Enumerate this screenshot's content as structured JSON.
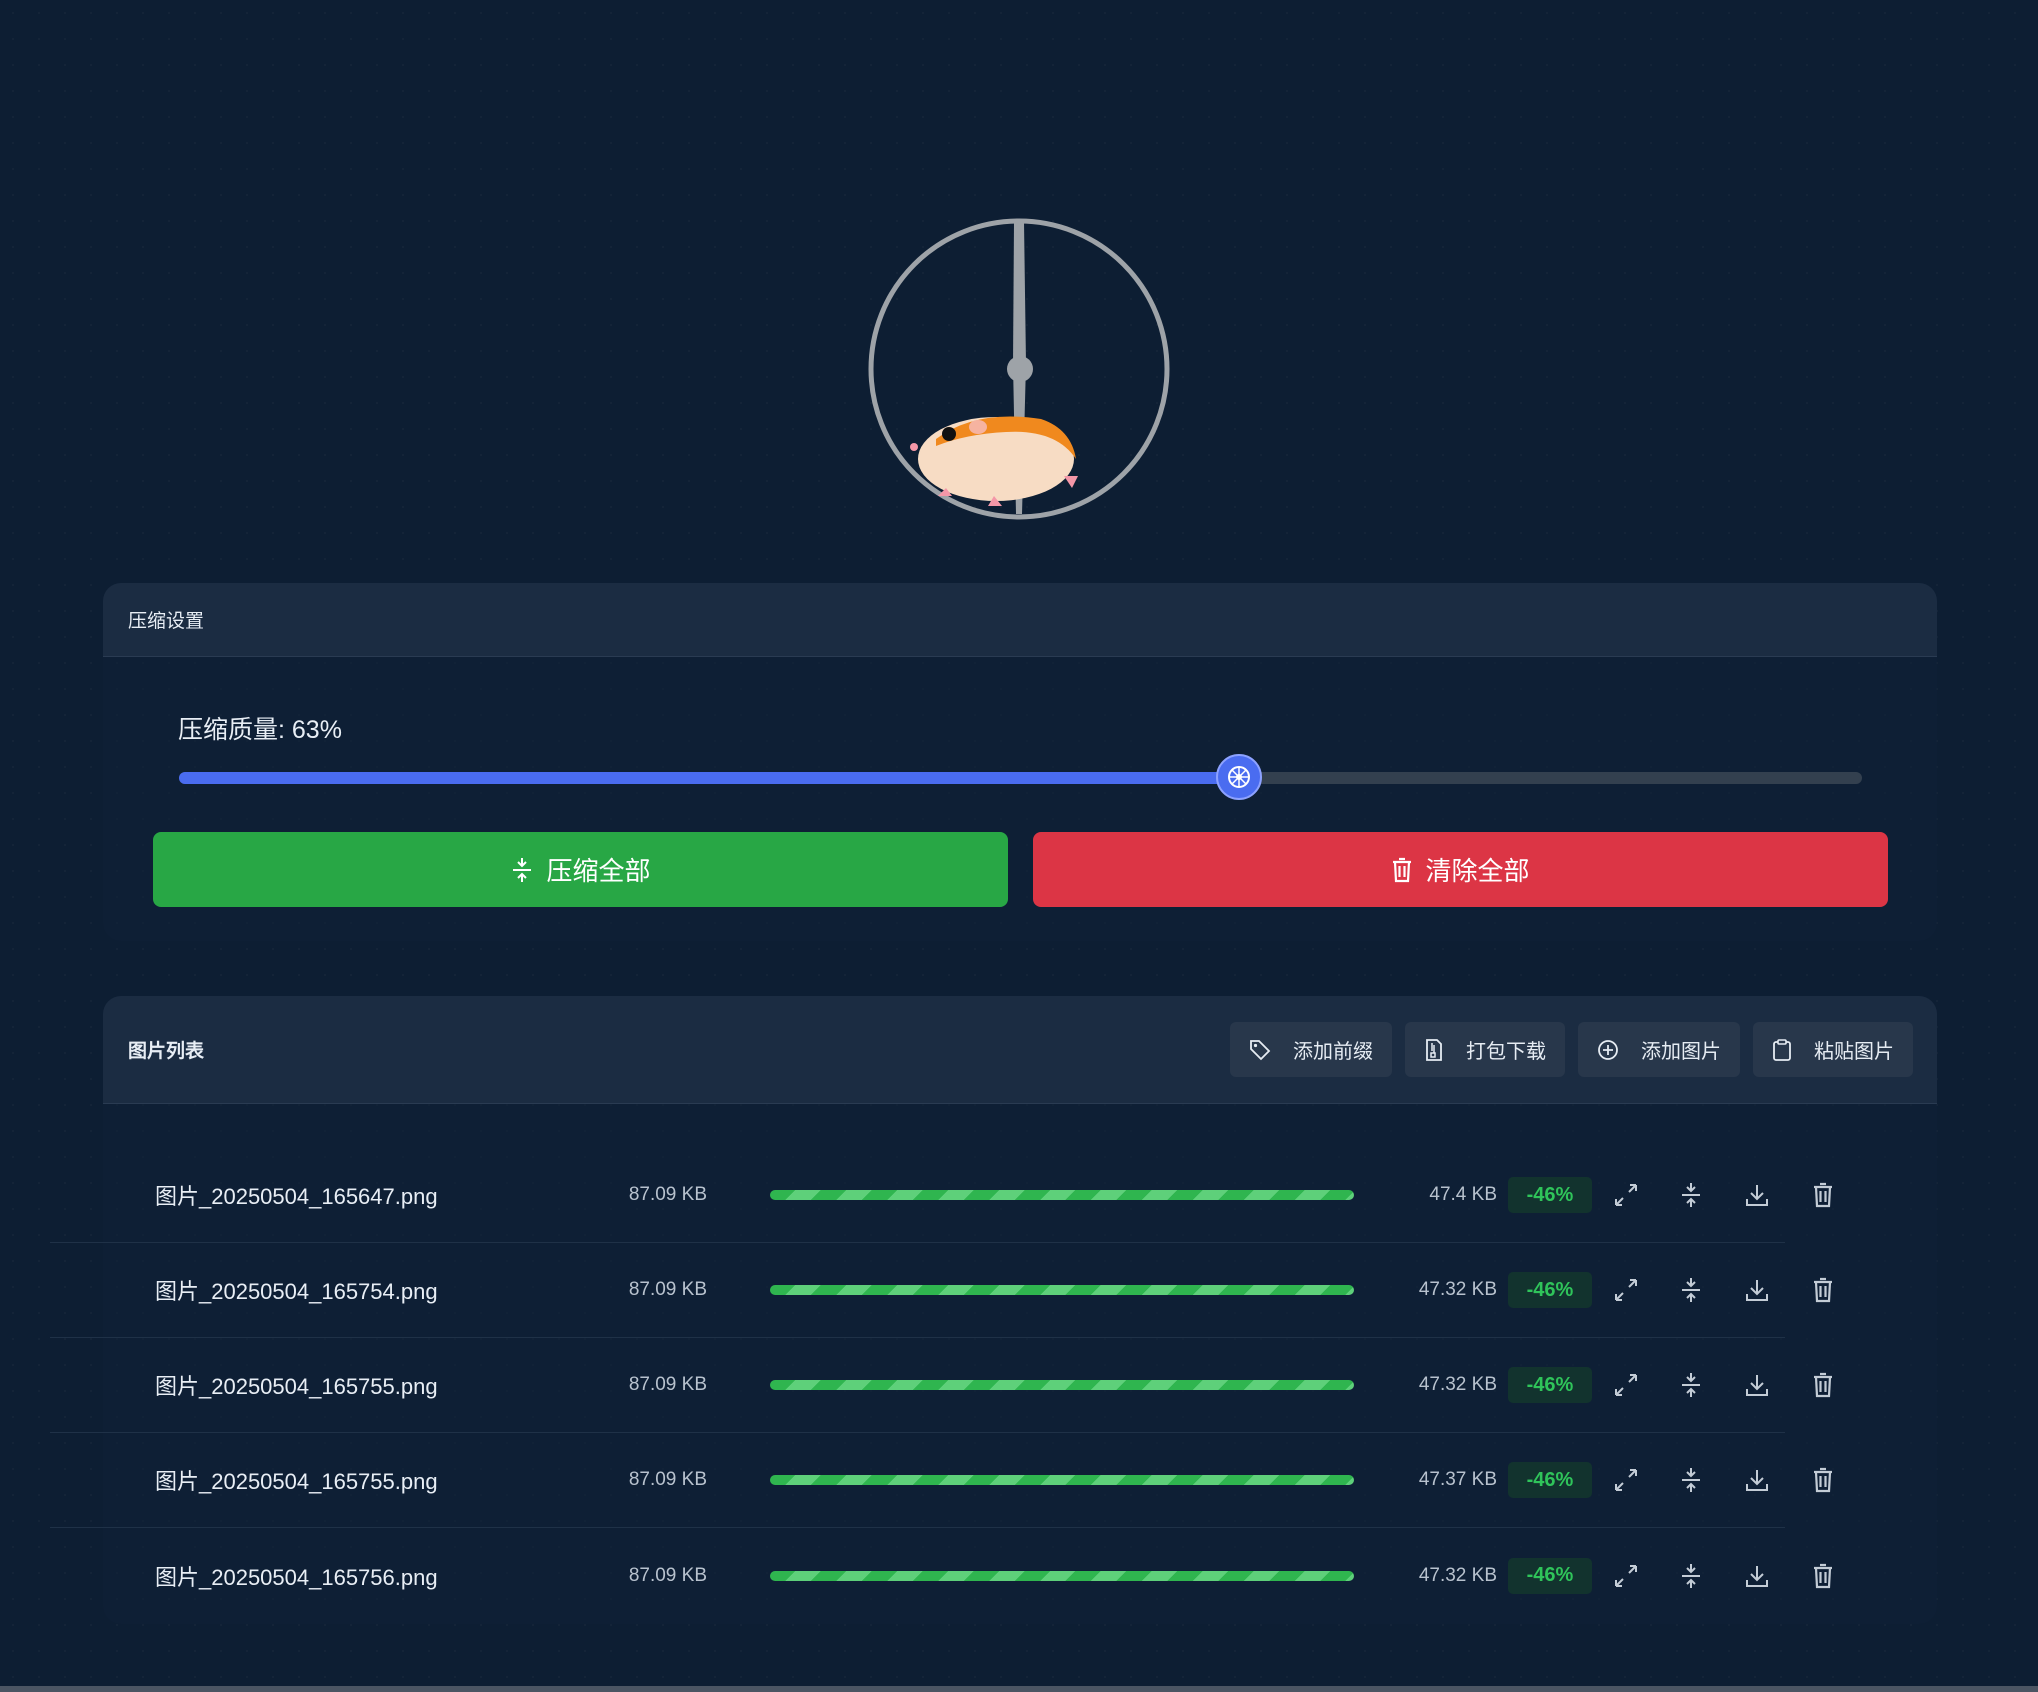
{
  "settings": {
    "title": "压缩设置",
    "quality_label": "压缩质量: 63%",
    "quality_value": 63,
    "compress_all_label": "压缩全部",
    "clear_all_label": "清除全部"
  },
  "list": {
    "title": "图片列表",
    "toolbar": [
      {
        "label": "添加前缀",
        "icon": "tag-icon"
      },
      {
        "label": "打包下载",
        "icon": "zip-file-icon"
      },
      {
        "label": "添加图片",
        "icon": "plus-circle-icon"
      },
      {
        "label": "粘贴图片",
        "icon": "clipboard-icon"
      }
    ],
    "items": [
      {
        "name": "图片_20250504_165647.png",
        "original_size": "87.09 KB",
        "new_size": "47.4 KB",
        "ratio": "-46%",
        "progress": 100
      },
      {
        "name": "图片_20250504_165754.png",
        "original_size": "87.09 KB",
        "new_size": "47.32 KB",
        "ratio": "-46%",
        "progress": 100
      },
      {
        "name": "图片_20250504_165755.png",
        "original_size": "87.09 KB",
        "new_size": "47.32 KB",
        "ratio": "-46%",
        "progress": 100
      },
      {
        "name": "图片_20250504_165755.png",
        "original_size": "87.09 KB",
        "new_size": "47.37 KB",
        "ratio": "-46%",
        "progress": 100
      },
      {
        "name": "图片_20250504_165756.png",
        "original_size": "87.09 KB",
        "new_size": "47.32 KB",
        "ratio": "-46%",
        "progress": 100
      }
    ],
    "row_actions": [
      "expand-icon",
      "compress-icon",
      "download-icon",
      "trash-icon"
    ]
  },
  "colors": {
    "accent": "#4a6cf0",
    "success": "#28a745",
    "danger": "#dc3545",
    "background": "#0d1e33"
  }
}
